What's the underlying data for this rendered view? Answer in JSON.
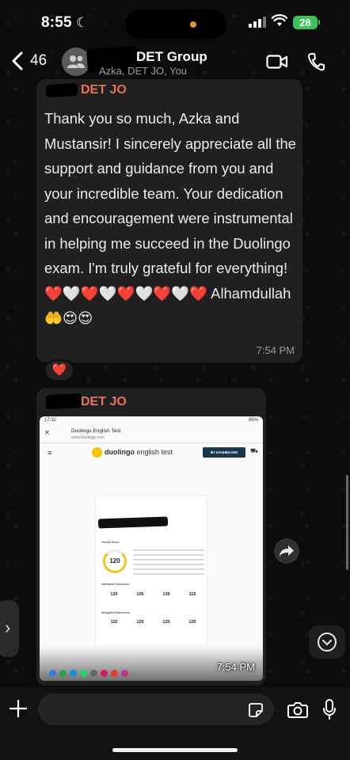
{
  "status_bar": {
    "time": "8:55",
    "battery": "28"
  },
  "header": {
    "back_count": "46",
    "group_name": "DET Group",
    "members": "Azka, DET JO, You"
  },
  "messages": [
    {
      "sender": "DET JO",
      "text": "Thank you so much, Azka and Mustansir! I sincerely appreciate all the support and guidance from you and your incredible team. Your dedication and encouragement were instrumental in helping me succeed in the Duolingo exam. I'm truly grateful for everything!❤️🤍❤️🤍❤️🤍❤️🤍❤️ Alhamdullah 🤲😍😍",
      "time": "7:54 PM",
      "reaction": "❤️"
    },
    {
      "sender": "DET JO",
      "time": "7:54 PM",
      "screenshot": {
        "status_time": "17:32",
        "status_right": "85%",
        "tab_title": "Duolingo English Test",
        "tab_url": "certs.duolingo.com",
        "brand_bold": "duolingo",
        "brand_rest": " english test",
        "dashboard_button": "MY DASHBOARD",
        "overall_label": "Overall Score",
        "overall_score": "120",
        "individual_label": "Individual Subscores",
        "individual_scores": [
          "120",
          "105",
          "135",
          "115"
        ],
        "integrated_label": "Integrated Subscores",
        "integrated_scores": [
          "115",
          "120",
          "125",
          "120"
        ]
      }
    }
  ],
  "input": {
    "placeholder": ""
  },
  "colors": {
    "sender": "#e5735c",
    "bubble": "#202020",
    "battery": "#3bc45b"
  }
}
